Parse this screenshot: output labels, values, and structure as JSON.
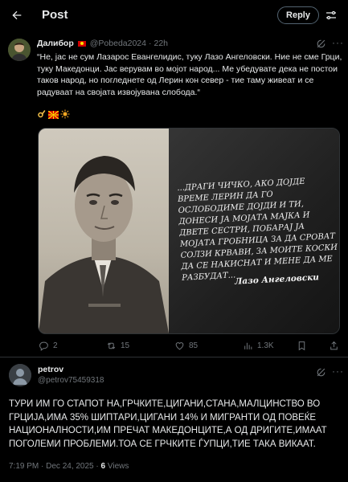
{
  "header": {
    "title": "Post",
    "reply_label": "Reply"
  },
  "post": {
    "author_name": "Далибор",
    "author_handle": "@Pobeda2024",
    "separator": "·",
    "time": "22h",
    "text": "“Не, јас не сум Лазарос  Евангелидис, туку Лазо Ангеловски. Ние не сме Грци, туку Македонци. Јас верувам во мојот народ... Ме убедувате дека не постои таков народ, но погледнете од Лерин кон север - тие таму живеат и се радуваат на својата извојувана слобода.“",
    "emoji_icons": [
      "hand-ok-emoji",
      "macedonian-flag-emoji",
      "sun-emoji"
    ],
    "image": {
      "quote": "...Драги чичко, ако дојде време Лерин да го ослободиме дојди и ти, донеси ја мојата мајка и двете сестри, побарај ја мојата гробница за да сроват солзи крвави, за моите коски да се накиснат и мене да ме разбудат...",
      "quote_author": "Лазо Ангеловски"
    },
    "stats": {
      "replies": "2",
      "reposts": "15",
      "likes": "85",
      "views": "1.3K"
    }
  },
  "reply": {
    "author_name": "petrov",
    "author_handle": "@petrov7545931​8",
    "text": "ТУРИ ИМ ГО СТАПОТ НА,ГРЧКИТЕ,ЦИГАНИ,СТАНА,МАЛЦИНСТВО ВО ГРЦИЈА,ИМА 35% ШИПТАРИ,ЦИГАНИ 14% И МИГРАНТИ ОД ПОВЕЌЕ НАЦИОНАЛНОСТИ,ИМ ПРЕЧАТ МАКЕДОНЦИТЕ,А ОД ДРИГИТЕ,ИМААТ ПОГОЛЕМИ ПРОБЛЕМИ.ТОА СЕ ГРЧКИТЕ ЃУПЦИ,ТИЕ ТАКА ВИКААТ.",
    "timestamp": "7:19 PM · Dec 24, 2025 · ",
    "views_count": "6",
    "views_label": " Views"
  },
  "colors": {
    "background": "#000000",
    "text": "#e7e9ea",
    "muted": "#71767b",
    "border": "#2f3336"
  }
}
